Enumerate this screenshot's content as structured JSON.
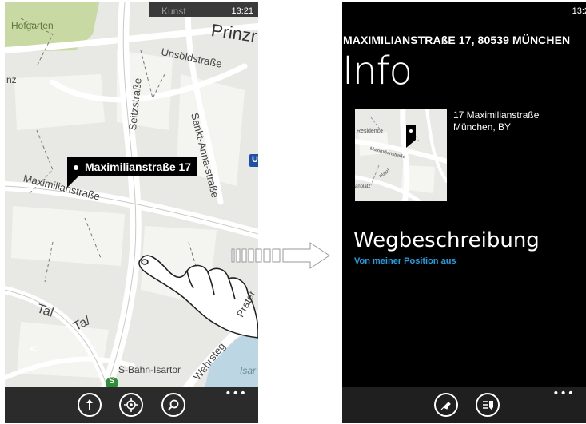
{
  "left_screen": {
    "status_time": "13:21",
    "map_labels": {
      "hofgarten": "Hofgarten",
      "kunst": "Kunst",
      "prinzr": "Prinzr",
      "unsoeldstrasse": "Unsöldstraße",
      "seitzstrasse": "Seitzstraße",
      "sankt_anna": "Sankt-Anna-straße",
      "maximilianstrasse": "Maximilianstraße",
      "nz": "nz",
      "tal1": "Tal",
      "tal2": "Ta/",
      "s_bahn_isartor": "S-Bahn-Isartor",
      "wehrsteg": "Wehrsteg",
      "prater": "Prater",
      "isar": "Isar",
      "u_badge": "U",
      "s_badge": "S"
    },
    "pushpin_label": "Maximilianstraße 17",
    "appbar": {
      "more": "•••"
    }
  },
  "right_screen": {
    "status_time": "13:2",
    "address_header": "MAXIMILIANSTRAßE 17, 80539 MÜNCHEN",
    "title": "Info",
    "address_line1": "17 Maximilianstraße",
    "address_line2": "München, BY",
    "thumbnail_labels": {
      "residence": "Residence",
      "maximilianstrasse": "Maximilianstraße",
      "platzl": "Platzl",
      "anplatz": "anplatz"
    },
    "directions_title": "Wegbeschreibung",
    "directions_subtitle": "Von meiner Position aus",
    "appbar": {
      "more": "•••"
    }
  },
  "colors": {
    "accent_blue": "#1ba1e2",
    "map_bg": "#e9e9e6",
    "park_green": "#c9d9a3",
    "water": "#b9d7e6"
  }
}
